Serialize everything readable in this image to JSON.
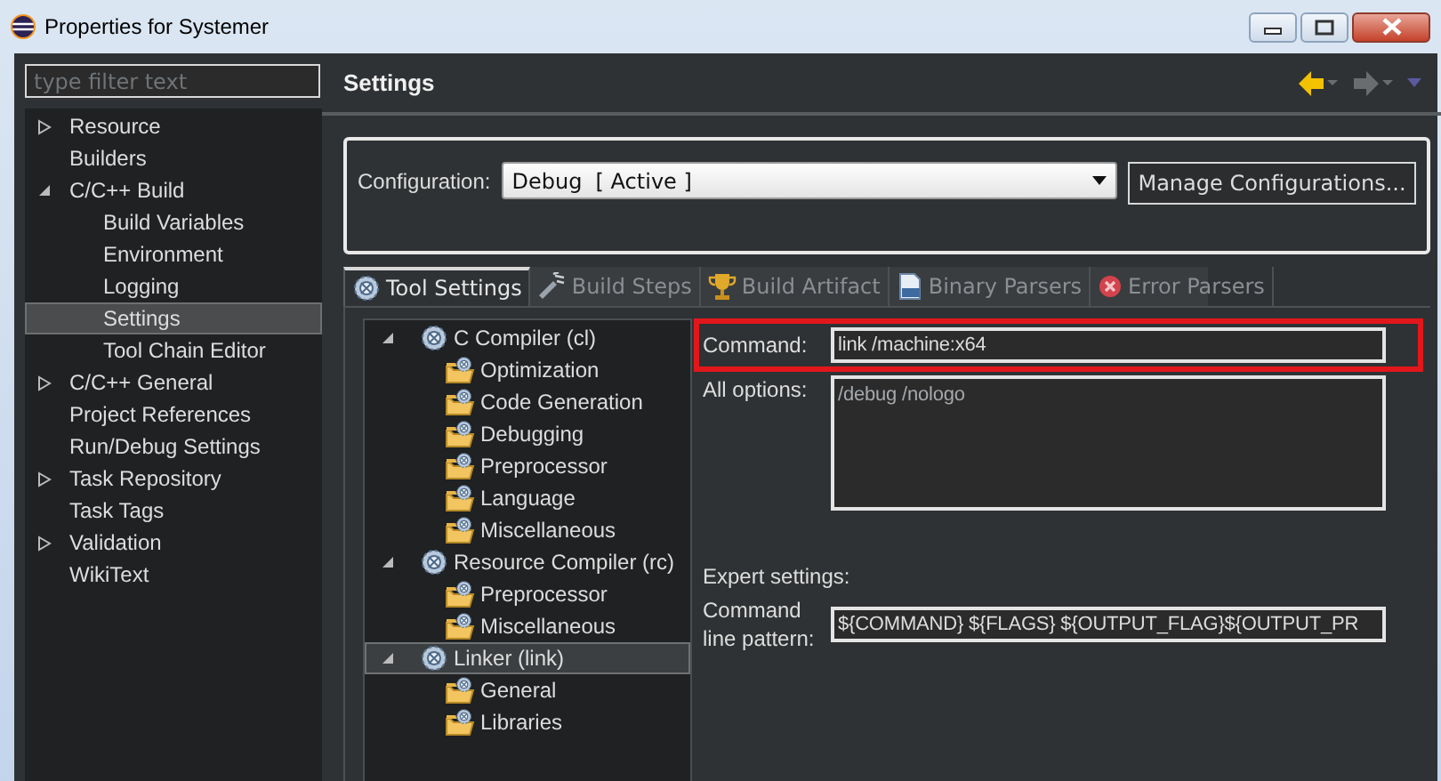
{
  "window": {
    "title": "Properties for Systemer"
  },
  "filter": {
    "placeholder": "type filter text"
  },
  "nav": [
    {
      "label": "Resource",
      "expanded": false,
      "selected": false
    },
    {
      "label": "Builders",
      "selected": false
    },
    {
      "label": "C/C++ Build",
      "expanded": true,
      "selected": false,
      "children": [
        {
          "label": "Build Variables",
          "selected": false
        },
        {
          "label": "Environment",
          "selected": false
        },
        {
          "label": "Logging",
          "selected": false
        },
        {
          "label": "Settings",
          "selected": true
        },
        {
          "label": "Tool Chain Editor",
          "selected": false
        }
      ]
    },
    {
      "label": "C/C++ General",
      "expanded": false,
      "selected": false
    },
    {
      "label": "Project References",
      "selected": false
    },
    {
      "label": "Run/Debug Settings",
      "selected": false
    },
    {
      "label": "Task Repository",
      "expanded": false,
      "selected": false
    },
    {
      "label": "Task Tags",
      "selected": false
    },
    {
      "label": "Validation",
      "expanded": false,
      "selected": false
    },
    {
      "label": "WikiText",
      "selected": false
    }
  ],
  "page_title": "Settings",
  "history": {
    "back_disabled": false,
    "forward_disabled": true
  },
  "configuration": {
    "label": "Configuration:",
    "value": "Debug  [ Active ]",
    "button": "Manage Configurations..."
  },
  "tabs": [
    {
      "label": "Tool Settings",
      "kind": "tool",
      "selected": true
    },
    {
      "label": "Build Steps",
      "kind": "steps",
      "selected": false
    },
    {
      "label": "Build Artifact",
      "kind": "artifact",
      "selected": false
    },
    {
      "label": "Binary Parsers",
      "kind": "binary",
      "selected": false
    },
    {
      "label": "Error Parsers",
      "kind": "error",
      "selected": false
    }
  ],
  "tool_tree": [
    {
      "label": "C Compiler (cl)",
      "expanded": true,
      "selected": false,
      "children": [
        {
          "label": "Optimization",
          "selected": false
        },
        {
          "label": "Code Generation",
          "selected": false
        },
        {
          "label": "Debugging",
          "selected": false
        },
        {
          "label": "Preprocessor",
          "selected": false
        },
        {
          "label": "Language",
          "selected": false
        },
        {
          "label": "Miscellaneous",
          "selected": false
        }
      ]
    },
    {
      "label": "Resource Compiler (rc)",
      "expanded": true,
      "selected": false,
      "children": [
        {
          "label": "Preprocessor",
          "selected": false
        },
        {
          "label": "Miscellaneous",
          "selected": false
        }
      ]
    },
    {
      "label": "Linker (link)",
      "expanded": true,
      "selected": true,
      "children": [
        {
          "label": "General",
          "selected": false
        },
        {
          "label": "Libraries",
          "selected": false
        }
      ]
    }
  ],
  "command": {
    "label": "Command:",
    "value": "link /machine:x64",
    "highlighted": true
  },
  "all_options": {
    "label": "All options:",
    "value": "/debug /nologo"
  },
  "expert": {
    "heading": "Expert settings:",
    "label": "Command line pattern:",
    "value": "${COMMAND} ${FLAGS} ${OUTPUT_FLAG}${OUTPUT_PR"
  }
}
